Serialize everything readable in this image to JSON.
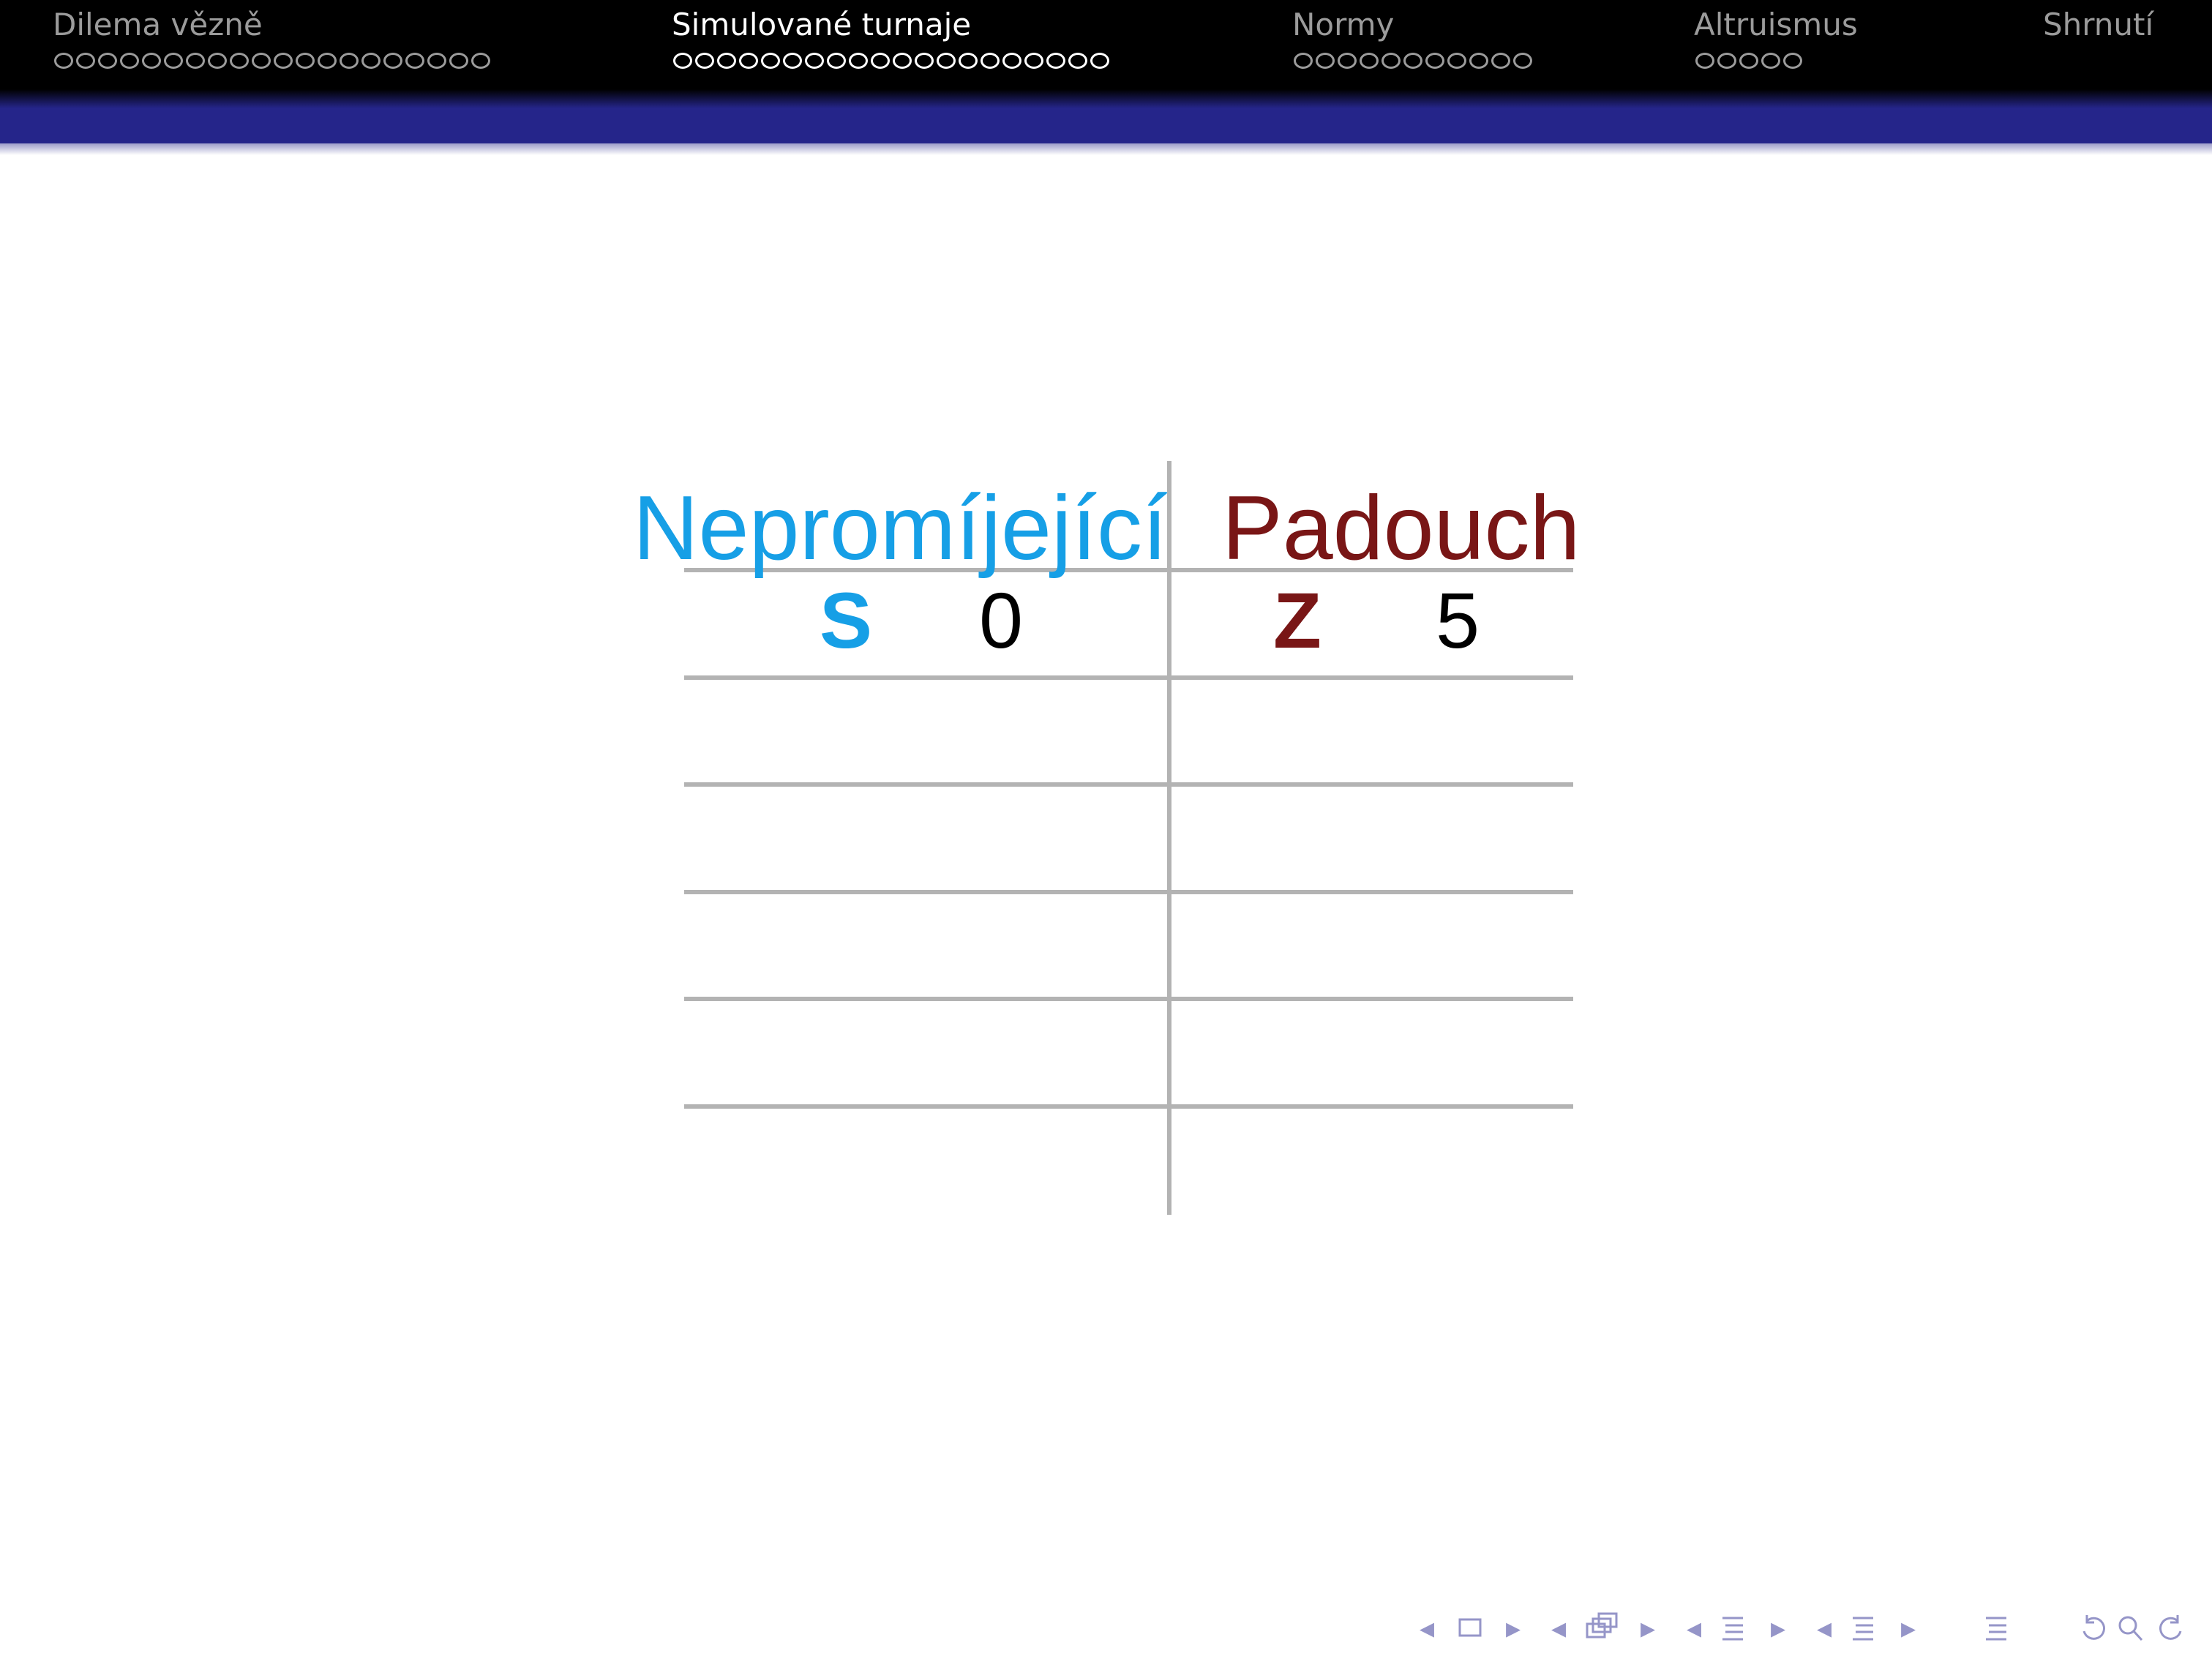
{
  "header": {
    "sections": [
      {
        "title": "Dilema vězně",
        "frames": 20,
        "active": false
      },
      {
        "title": "Simulované turnaje",
        "frames": 20,
        "active": true
      },
      {
        "title": "Normy",
        "frames": 11,
        "active": false
      },
      {
        "title": "Altruismus",
        "frames": 5,
        "active": false
      },
      {
        "title": "Shrnutí",
        "frames": 0,
        "active": false
      }
    ]
  },
  "table": {
    "left_header": "Nepromíjející",
    "right_header": "Padouch",
    "rows": [
      {
        "left_move": "S",
        "left_score": "0",
        "right_move": "Z",
        "right_score": "5"
      }
    ]
  },
  "colors": {
    "left_player": "#169fe6",
    "right_player": "#791616",
    "header_band": "#25258a",
    "grid": "#b3b3b3"
  },
  "navigation": {
    "icons": [
      "arrow-left-icon",
      "frame-icon",
      "arrow-right-icon",
      "subsection-icon",
      "section-icon",
      "appendix-icon",
      "search-icon",
      "undo-icon"
    ]
  }
}
